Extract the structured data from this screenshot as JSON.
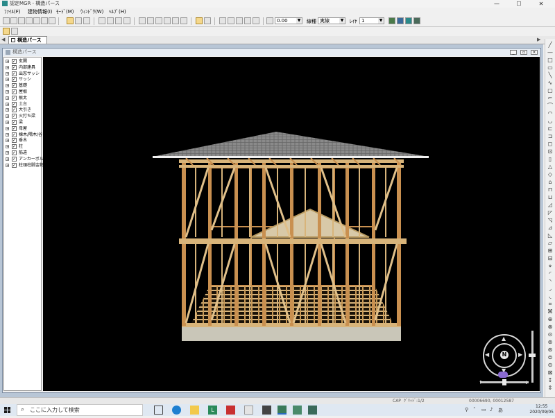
{
  "window": {
    "title": "認定MGR - 構造パース",
    "min": "—",
    "max": "☐",
    "close": "✕"
  },
  "menu": [
    {
      "label": "ﾌｧｲﾙ(F)"
    },
    {
      "label": "建物情報(I)"
    },
    {
      "label": "ﾓｰﾄﾞ(M)"
    },
    {
      "label": "ｳｨﾝﾄﾞｳ(W)"
    },
    {
      "label": "ﾍﾙﾌﾟ(H)"
    }
  ],
  "toolbar": {
    "angle_value": "0.00",
    "linetype_label": "線種",
    "linetype_value": "実線",
    "layer_label": "ﾚｲﾔ",
    "layer_value": "1"
  },
  "tabs": [
    {
      "label": "構造パース"
    }
  ],
  "mdi": {
    "title": "構造パース"
  },
  "tree": {
    "items": [
      {
        "label": "玄関"
      },
      {
        "label": "内部建具"
      },
      {
        "label": "出窓サッシ"
      },
      {
        "label": "サッシ"
      },
      {
        "label": "基礎"
      },
      {
        "label": "屋根"
      },
      {
        "label": "根太"
      },
      {
        "label": "土台"
      },
      {
        "label": "大引き"
      },
      {
        "label": "火打ち梁"
      },
      {
        "label": "梁"
      },
      {
        "label": "母屋"
      },
      {
        "label": "棟木/隅木/谷"
      },
      {
        "label": "垂木"
      },
      {
        "label": "柱"
      },
      {
        "label": "筋違"
      },
      {
        "label": "アンカーボルト"
      },
      {
        "label": "柱頭柱脚金物"
      }
    ]
  },
  "nav": {
    "center_label": "N"
  },
  "statusbar": {
    "mode": "CAP",
    "grid_label": "ｸﾞﾘｯﾄﾞ:1/2",
    "coords": "00006690, 00012587"
  },
  "taskbar": {
    "search_placeholder": "ここに入力して検索",
    "time": "12:55",
    "date": "2020/09/05"
  },
  "colors": {
    "accent": "#2a8a8a",
    "viewport_bg": "#000000",
    "lumber": "#d8b47a",
    "post": "#c99050",
    "roof": "#7a7a7a"
  }
}
